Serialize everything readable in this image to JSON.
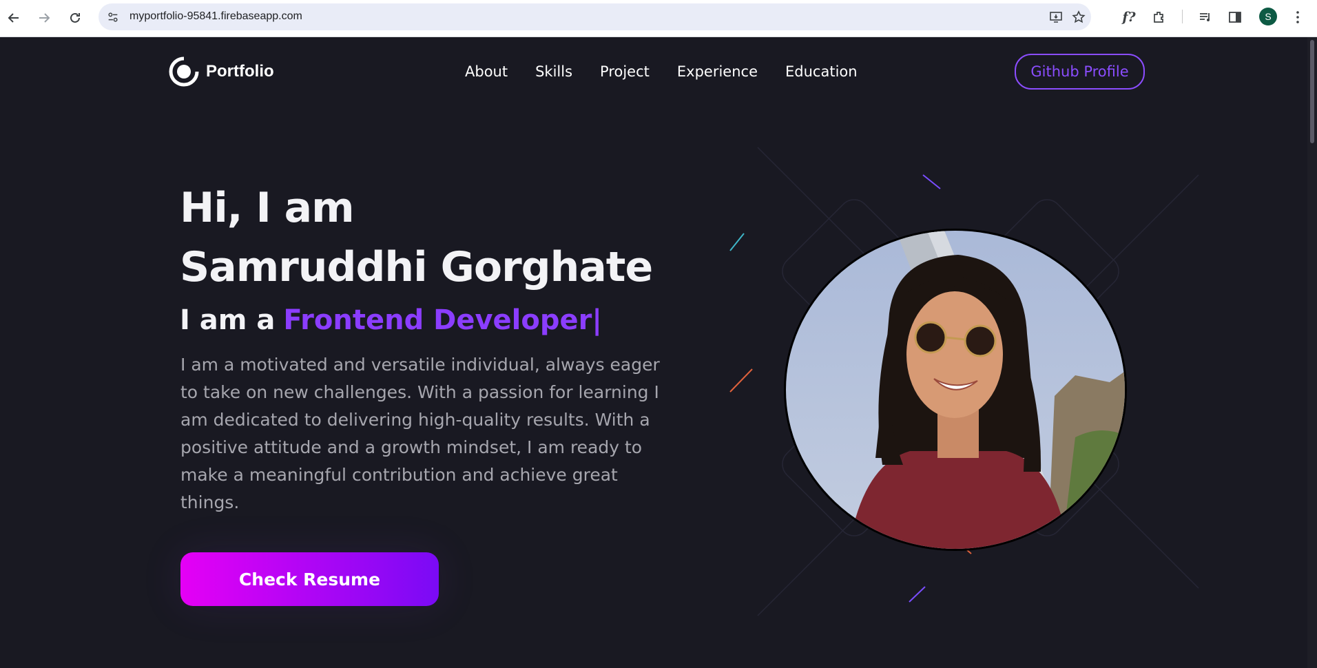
{
  "browser": {
    "url": "myportfolio-95841.firebaseapp.com",
    "profile_initial": "S",
    "icons": [
      "back-icon",
      "forward-icon",
      "reload-icon",
      "site-info-icon",
      "install-icon",
      "bookmark-star-icon",
      "formula-extension-icon",
      "extensions-icon",
      "media-controls-icon",
      "side-panel-icon",
      "kebab-menu-icon"
    ],
    "extension_label": "f?"
  },
  "header": {
    "logo_text": "Portfolio",
    "menu": [
      {
        "label": "About"
      },
      {
        "label": "Skills"
      },
      {
        "label": "Project"
      },
      {
        "label": "Experience"
      },
      {
        "label": "Education"
      }
    ],
    "github_button": "Github Profile"
  },
  "hero": {
    "greeting_line1": "Hi, I am",
    "greeting_line2": "Samruddhi Gorghate",
    "role_prefix": "I am a",
    "role_highlight": "Frontend Developer|",
    "bio": "I am a motivated and versatile individual, always eager to take on new challenges. With a passion for learning I am dedicated to delivering high-quality results. With a positive attitude and a growth mindset, I am ready to make a meaningful contribution and achieve great things.",
    "resume_button": "Check Resume"
  },
  "colors": {
    "page_bg": "#191922",
    "accent": "#8b3dff",
    "button_gradient_start": "#e500f5",
    "button_gradient_end": "#7a0af5",
    "bio_text": "#a6a6ae"
  }
}
